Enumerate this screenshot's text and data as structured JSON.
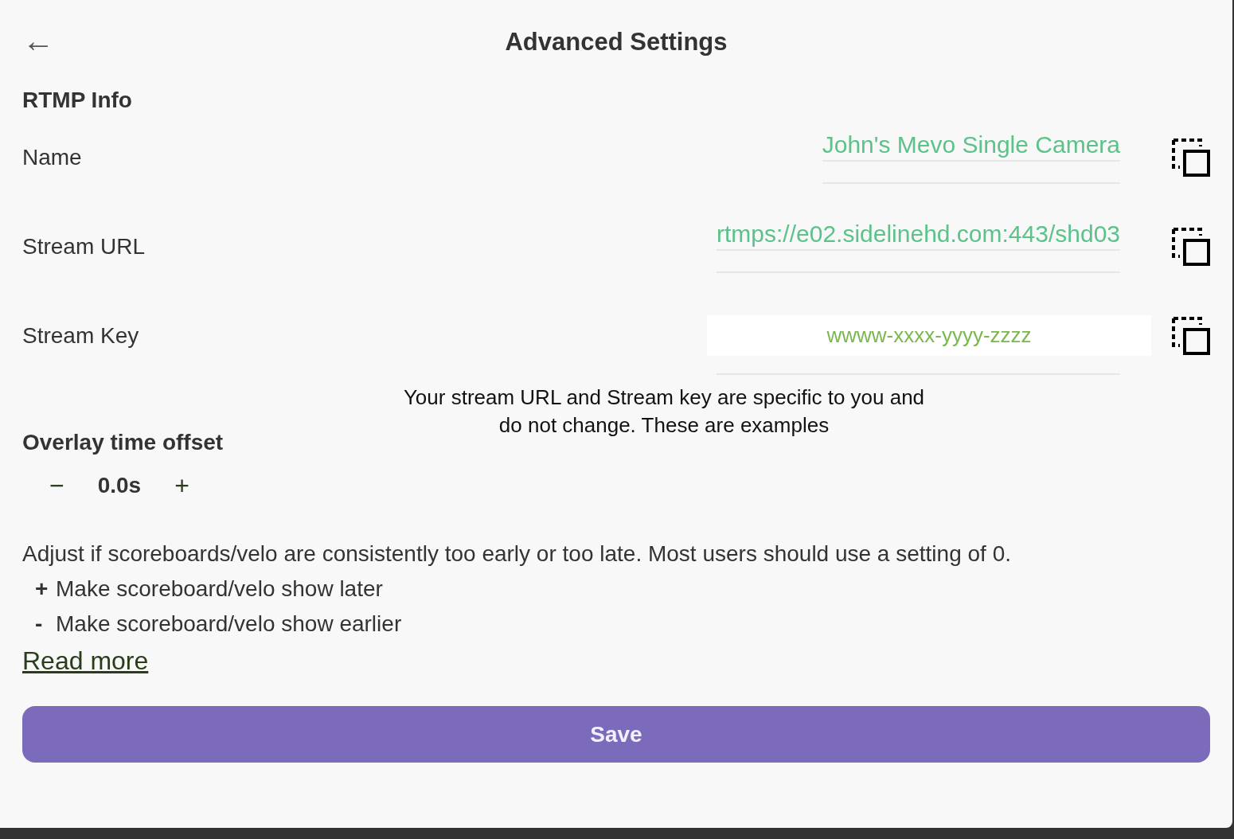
{
  "header": {
    "back": "←",
    "title": "Advanced Settings"
  },
  "rtmp": {
    "title": "RTMP Info",
    "fields": [
      {
        "label": "Name",
        "value": "John's Mevo Single Camera",
        "kind": "line"
      },
      {
        "label": "Stream URL",
        "value": "rtmps://e02.sidelinehd.com:443/shd03",
        "kind": "line"
      },
      {
        "label": "Stream Key",
        "value": "wwww-xxxx-yyyy-zzzz",
        "kind": "box"
      }
    ],
    "hint": "Your stream URL and Stream key are specific to you and do not change. These are examples"
  },
  "overlay": {
    "title": "Overlay time offset",
    "minus": "−",
    "value": "0.0s",
    "plus": "+",
    "description": "Adjust if scoreboards/velo are consistently too early or too late. Most users should use a setting of 0.",
    "notes": [
      {
        "sign": "+",
        "text": "Make scoreboard/velo show later"
      },
      {
        "sign": "-",
        "text": "Make scoreboard/velo show earlier"
      }
    ],
    "link": "Read more"
  },
  "save": "Save"
}
